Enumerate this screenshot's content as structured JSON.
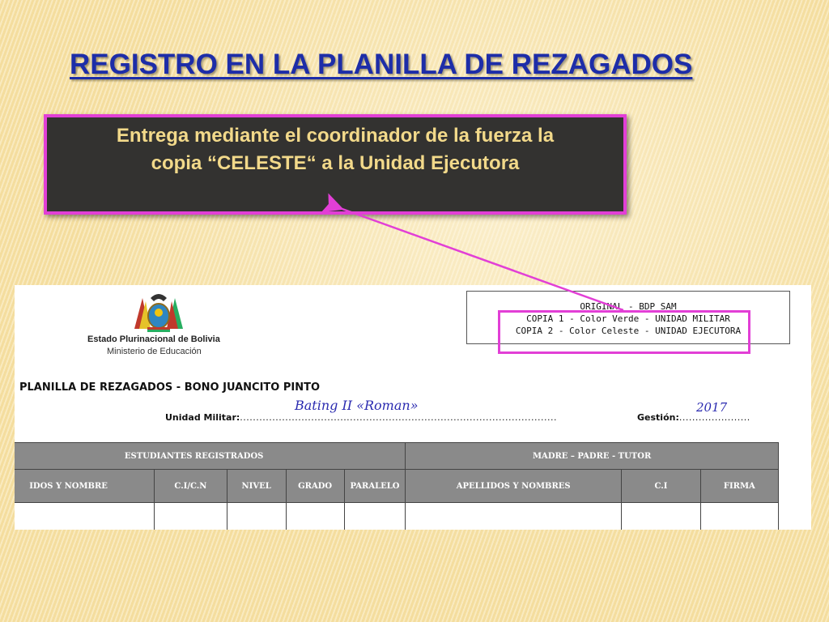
{
  "title": "REGISTRO EN LA PLANILLA DE REZAGADOS",
  "callout": {
    "line1": "Entrega  mediante el coordinador de la fuerza la",
    "line2": "copia “CELESTE“ a la Unidad Ejecutora"
  },
  "document": {
    "institution": "Estado Plurinacional de Bolivia",
    "ministry": "Ministerio de Educación",
    "copies": [
      "ORIGINAL - BDP SAM",
      "COPIA 1 - Color Verde - UNIDAD MILITAR",
      "COPIA 2 - Color Celeste - UNIDAD EJECUTORA"
    ],
    "form_title": "PLANILLA DE REZAGADOS - BONO JUANCITO PINTO",
    "unidad_label": "Unidad Militar:",
    "unidad_dots": "..................................................................................................",
    "gestion_label": "Gestión:",
    "gestion_dots": "......................",
    "handwritten_unit": "Bating II  «Roman»",
    "handwritten_year": "2017",
    "table": {
      "group_left": "ESTUDIANTES REGISTRADOS",
      "group_right": "MADRE – PADRE - TUTOR",
      "columns": [
        "IDOS Y NOMBRE",
        "C.I/C.N",
        "NIVEL",
        "GRADO",
        "PARALELO",
        "APELLIDOS Y NOMBRES",
        "C.I",
        "FIRMA"
      ]
    }
  },
  "colors": {
    "title": "#1d2da8",
    "callout_bg": "#333230",
    "callout_text": "#f2d98a",
    "highlight": "#e23fd6",
    "handwriting": "#2b2bb0",
    "table_header": "#8a8a8a"
  }
}
